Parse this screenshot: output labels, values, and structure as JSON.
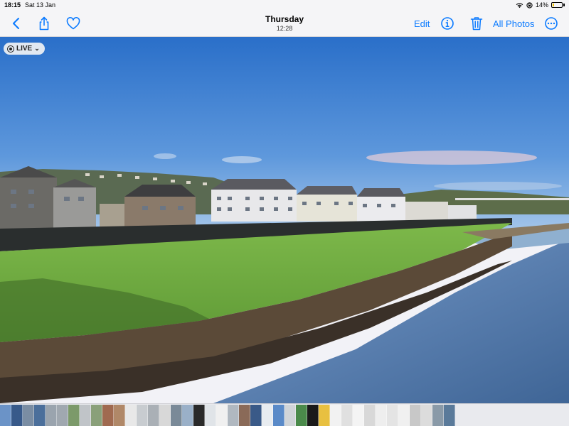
{
  "status": {
    "time": "18:15",
    "date": "Sat 13 Jan",
    "battery_text": "14%",
    "battery_level": 0.14
  },
  "toolbar": {
    "title": "Thursday",
    "subtitle": "12:28",
    "edit_label": "Edit",
    "all_photos_label": "All Photos",
    "accent": "#0a7aff"
  },
  "photo": {
    "live_label": "LIVE"
  },
  "icons": [
    "chevron-left-icon",
    "share-icon",
    "heart-icon",
    "info-icon",
    "trash-icon",
    "more-icon",
    "wifi-icon",
    "rotation-lock-icon",
    "battery-icon",
    "live-icon",
    "chevron-down-icon"
  ],
  "thumbnails": [
    {
      "c": "#6b93c7"
    },
    {
      "c": "#385a8a"
    },
    {
      "c": "#7a8da3"
    },
    {
      "c": "#4b6f9b"
    },
    {
      "c": "#9aa4ae"
    },
    {
      "c": "#a0a8b0"
    },
    {
      "c": "#7c9a6a"
    },
    {
      "c": "#c0c4c8"
    },
    {
      "c": "#8aa07a"
    },
    {
      "c": "#a06a50"
    },
    {
      "c": "#b08868"
    },
    {
      "c": "#e8e8e8"
    },
    {
      "c": "#c8ccd0"
    },
    {
      "c": "#aab0b6"
    },
    {
      "c": "#d8d8d8"
    },
    {
      "c": "#7a8a98"
    },
    {
      "c": "#9ab0c8"
    },
    {
      "c": "#2a2a2a"
    },
    {
      "c": "#e0e4e8"
    },
    {
      "c": "#f0f0f0"
    },
    {
      "c": "#b0b8c0"
    },
    {
      "c": "#8a6a58"
    },
    {
      "c": "#3a5a88"
    },
    {
      "c": "#e8ecf0"
    },
    {
      "c": "#5a8ac8"
    },
    {
      "c": "#d0d4d8"
    },
    {
      "c": "#4a8a4a"
    },
    {
      "c": "#1a1a1a"
    },
    {
      "c": "#e8c040"
    },
    {
      "c": "#f2f2f2"
    },
    {
      "c": "#e0e0e0"
    },
    {
      "c": "#f4f4f4"
    },
    {
      "c": "#d8d8d8"
    },
    {
      "c": "#eeeeee"
    },
    {
      "c": "#e4e4e4"
    },
    {
      "c": "#f0f0f0"
    },
    {
      "c": "#c8c8c8"
    },
    {
      "c": "#dcdcdc"
    },
    {
      "c": "#8a9aa8"
    },
    {
      "c": "#5a7a9a"
    }
  ]
}
